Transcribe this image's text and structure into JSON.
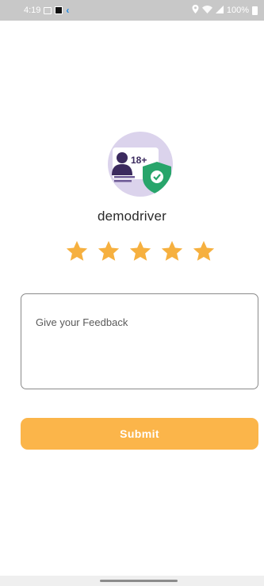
{
  "status_bar": {
    "time": "4:19",
    "battery": "100%",
    "icons": [
      "image-icon",
      "notification-icon",
      "flutter-icon",
      "location-icon",
      "wifi-icon",
      "signal-icon",
      "battery-icon"
    ]
  },
  "profile": {
    "avatar_badge_text": "18+",
    "avatar_icon": "verified-adult-id-icon",
    "name": "demodriver"
  },
  "rating": {
    "value": 5,
    "max": 5,
    "star_color": "#F6B03F"
  },
  "feedback": {
    "placeholder": "Give your Feedback",
    "value": ""
  },
  "submit": {
    "label": "Submit",
    "color": "#FBB54A"
  }
}
